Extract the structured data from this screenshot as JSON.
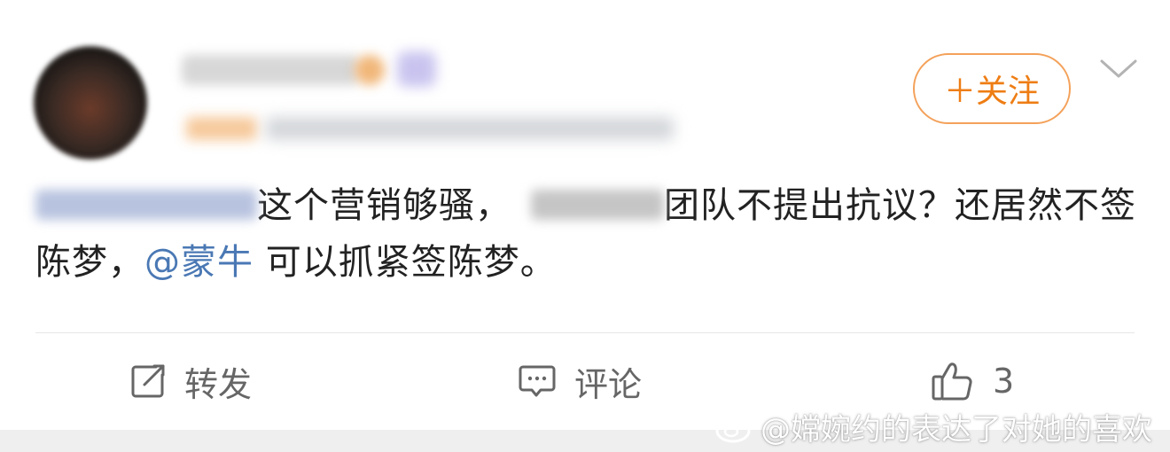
{
  "post": {
    "follow_label": "＋关注",
    "content": {
      "part1": "这个营销够骚，",
      "part2": "团队不提出抗议？还居然不签陈梦，",
      "mention": "@蒙牛",
      "part3": " 可以抓紧签陈梦。"
    },
    "actions": {
      "repost_label": "转发",
      "comment_label": "评论",
      "like_count": "3"
    }
  },
  "watermark": {
    "text": "@嫦婉约的表达了对她的喜欢"
  },
  "colors": {
    "accent": "#ee7d14",
    "mention": "#4a78b4",
    "text": "#222222",
    "muted": "#666666"
  }
}
